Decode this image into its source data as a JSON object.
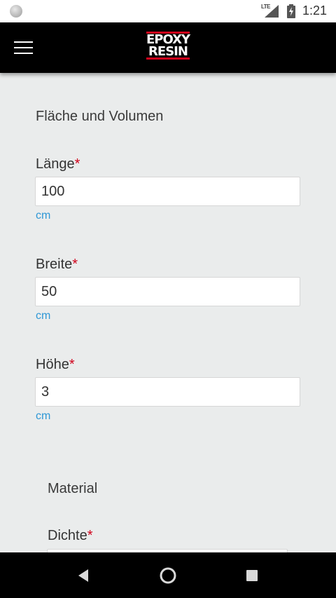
{
  "status_bar": {
    "network_label": "LTE",
    "time": "1:21"
  },
  "app_bar": {
    "logo_line1": "EPOXY",
    "logo_line2": "RESIN"
  },
  "section_surface": {
    "title": "Fläche und Volumen",
    "fields": [
      {
        "label": "Länge",
        "required_mark": "*",
        "value": "100",
        "unit": "cm"
      },
      {
        "label": "Breite",
        "required_mark": "*",
        "value": "50",
        "unit": "cm"
      },
      {
        "label": "Höhe",
        "required_mark": "*",
        "value": "3",
        "unit": "cm"
      }
    ]
  },
  "section_material": {
    "title": "Material",
    "fields": [
      {
        "label": "Dichte",
        "required_mark": "*",
        "value": ""
      }
    ]
  },
  "colors": {
    "accent_red": "#d0021b",
    "unit_blue": "#2f98d6",
    "background": "#eaecec",
    "bar_black": "#000000"
  }
}
